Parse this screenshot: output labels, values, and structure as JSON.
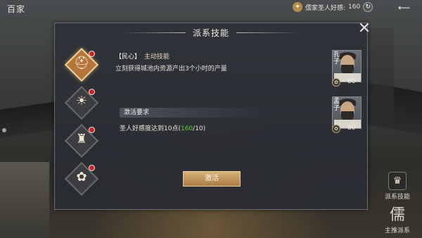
{
  "top": {
    "title": "百家",
    "favor_label": "儒家圣人好感:",
    "favor_value": "160"
  },
  "panel": {
    "title": "派系技能",
    "close_icon": "close-icon"
  },
  "skills": [
    {
      "icon": "people-icon",
      "glyph": "⛑",
      "active": true
    },
    {
      "icon": "sunrise-icon",
      "glyph": "☀",
      "active": false
    },
    {
      "icon": "tower-icon",
      "glyph": "♜",
      "active": false
    },
    {
      "icon": "fan-icon",
      "glyph": "✿",
      "active": false
    }
  ],
  "detail": {
    "name": "【民心】",
    "tag": "主动技能",
    "description": "立刻获得城池内资源产出3个小时的产量",
    "requirement_title": "激活要求",
    "requirement_prefix": "圣人好感度达到10点(",
    "requirement_current": "160",
    "requirement_suffix": "/10)",
    "activate_label": "激活"
  },
  "sages": [
    {
      "name": "孔子",
      "value": "80"
    },
    {
      "name": "孟子",
      "value": "80"
    }
  ],
  "side": {
    "skill_label": "派系技能",
    "master_label": "主推派系",
    "master_glyph": "儒"
  },
  "colors": {
    "accent": "#d7b27a",
    "requirement_met": "#55d43a",
    "active_skill": "#b5743a"
  }
}
